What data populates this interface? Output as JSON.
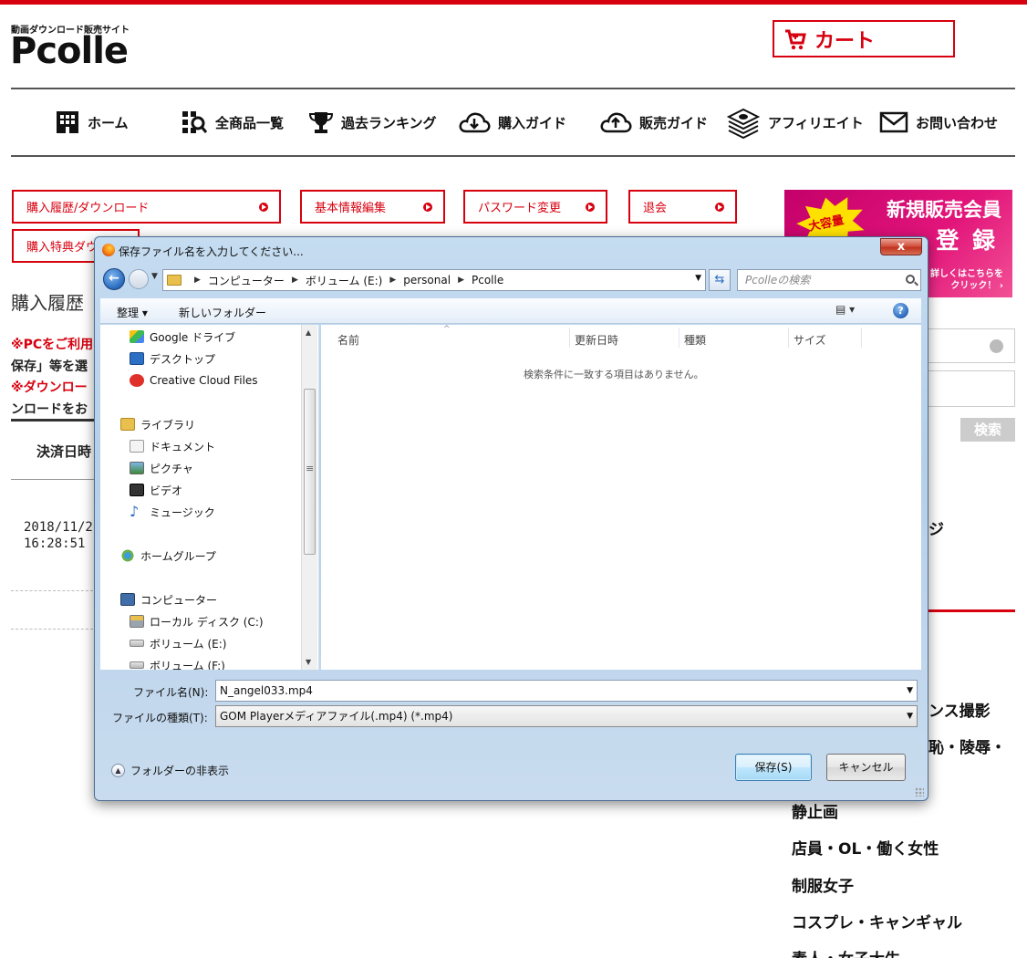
{
  "site": {
    "logo_sub": "動画ダウンロード販売サイト",
    "logo": "Pcolle",
    "cart_label": "カート",
    "accent": "#d7000f"
  },
  "nav": [
    {
      "label": "ホーム",
      "icon": "building-icon"
    },
    {
      "label": "全商品一覧",
      "icon": "grid-search-icon"
    },
    {
      "label": "過去ランキング",
      "icon": "trophy-icon"
    },
    {
      "label": "購入ガイド",
      "icon": "cloud-download-icon"
    },
    {
      "label": "販売ガイド",
      "icon": "cloud-upload-icon"
    },
    {
      "label": "アフィリエイト",
      "icon": "money-stack-icon"
    },
    {
      "label": "お問い合わせ",
      "icon": "mail-icon"
    }
  ],
  "account_buttons": {
    "history": "購入履歴/ダウンロード",
    "profile": "基本情報編集",
    "password": "パスワード変更",
    "withdraw": "退会",
    "bonus": "購入特典ダウ"
  },
  "banner": {
    "line1": "新規販売会員",
    "line2": "登 録",
    "burst": "大容量",
    "cta1": "詳しくはこちらを",
    "cta2": "クリック！ ›"
  },
  "page": {
    "heading": "購入履歴",
    "note1": "※PCをご利用",
    "note2": "保存」等を選",
    "note3": "※ダウンロー",
    "note4": "ンロードをお",
    "col_paid": "決済日時",
    "row_date": "2018/11/2",
    "row_time": "16:28:51"
  },
  "sidebar": {
    "search_button": "検索",
    "partial_text": "ジ",
    "categories": [
      "ンス撮影",
      "恥・陵辱・",
      "静止画",
      "店員・OL・働く女性",
      "制服女子",
      "コスプレ・キャンギャル",
      "素人・女子大生"
    ]
  },
  "dialog": {
    "title": "保存ファイル名を入力してください...",
    "close": "x",
    "breadcrumb": [
      "コンピューター",
      "ボリューム (E:)",
      "personal",
      "Pcolle"
    ],
    "search_placeholder": "Pcolleの検索",
    "organize": "整理 ▾",
    "new_folder": "新しいフォルダー",
    "view_icon": "▤ ▾",
    "help": "?",
    "nav_items": [
      {
        "label": "Google ドライブ",
        "icon": "google-drive-icon"
      },
      {
        "label": "デスクトップ",
        "icon": "desktop-icon"
      },
      {
        "label": "Creative Cloud Files",
        "icon": "creative-cloud-icon"
      },
      {
        "label": "ライブラリ",
        "icon": "library-icon"
      },
      {
        "label": "ドキュメント",
        "icon": "document-icon"
      },
      {
        "label": "ピクチャ",
        "icon": "picture-icon"
      },
      {
        "label": "ビデオ",
        "icon": "video-icon"
      },
      {
        "label": "ミュージック",
        "icon": "music-icon"
      },
      {
        "label": "ホームグループ",
        "icon": "homegroup-icon"
      },
      {
        "label": "コンピューター",
        "icon": "computer-icon"
      },
      {
        "label": "ローカル ディスク (C:)",
        "icon": "local-disk-icon"
      },
      {
        "label": "ボリューム (E:)",
        "icon": "drive-icon"
      },
      {
        "label": "ボリューム (F:)",
        "icon": "drive-icon"
      }
    ],
    "columns": [
      "名前",
      "更新日時",
      "種類",
      "サイズ"
    ],
    "empty_message": "検索条件に一致する項目はありません。",
    "filename_label": "ファイル名(N):",
    "filename_value": "N_angel033.mp4",
    "filetype_label": "ファイルの種類(T):",
    "filetype_value": "GOM Playerメディアファイル(.mp4) (*.mp4)",
    "hide_folders": "フォルダーの非表示",
    "save": "保存(S)",
    "cancel": "キャンセル"
  }
}
